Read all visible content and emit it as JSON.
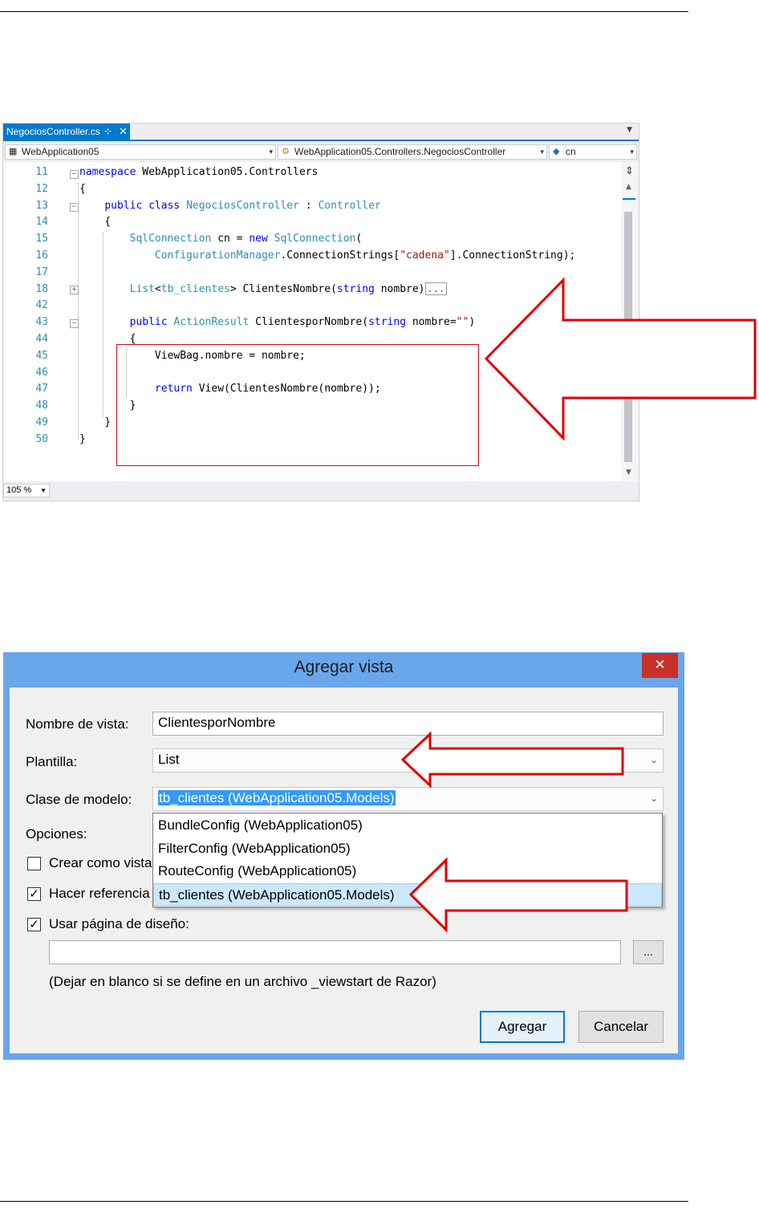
{
  "editor": {
    "tab": {
      "label": "NegociosController.cs",
      "pin_icon": "pin-icon",
      "close_icon": "close-icon"
    },
    "nav": {
      "project": "WebApplication05",
      "class": "WebApplication05.Controllers.NegociosController",
      "member": "cn"
    },
    "lines": [
      {
        "num": "11",
        "html": "<span class=\"kw\">namespace</span> WebApplication05.Controllers"
      },
      {
        "num": "12",
        "html": "{"
      },
      {
        "num": "13",
        "html": "    <span class=\"kw\">public</span> <span class=\"kw\">class</span> <span class=\"ty\">NegociosController</span> : <span class=\"ty\">Controller</span>"
      },
      {
        "num": "14",
        "html": "    {"
      },
      {
        "num": "15",
        "html": "        <span class=\"ty\">SqlConnection</span> cn = <span class=\"kw\">new</span> <span class=\"ty\">SqlConnection</span>("
      },
      {
        "num": "16",
        "html": "            <span class=\"ty\">ConfigurationManager</span>.ConnectionStrings[<span class=\"str\">\"cadena\"</span>].ConnectionString);"
      },
      {
        "num": "17",
        "html": ""
      },
      {
        "num": "18",
        "html": "        <span class=\"ty\">List</span>&lt;<span class=\"ty\">tb_clientes</span>&gt; ClientesNombre(<span class=\"kw\">string</span> nombre)<span class=\"collapsed\">...</span>"
      },
      {
        "num": "42",
        "html": ""
      },
      {
        "num": "43",
        "html": "        <span class=\"kw\">public</span> <span class=\"ty\">ActionResult</span> ClientesporNombre(<span class=\"kw\">string</span> nombre=<span class=\"str\">\"\"</span>)"
      },
      {
        "num": "44",
        "html": "        {"
      },
      {
        "num": "45",
        "html": "            ViewBag.nombre = nombre;"
      },
      {
        "num": "46",
        "html": ""
      },
      {
        "num": "47",
        "html": "            <span class=\"kw\">return</span> View(ClientesNombre(nombre));"
      },
      {
        "num": "48",
        "html": "        }"
      },
      {
        "num": "49",
        "html": "    }"
      },
      {
        "num": "50",
        "html": "}"
      }
    ],
    "zoom": "105 %"
  },
  "dialog": {
    "title": "Agregar vista",
    "close_icon": "close-icon",
    "view_name_label": "Nombre de vista:",
    "view_name_value": "ClientesporNombre",
    "template_label": "Plantilla:",
    "template_value": "List",
    "model_label": "Clase de modelo:",
    "model_value": "tb_clientes (WebApplication05.Models)",
    "model_options": [
      "BundleConfig (WebApplication05)",
      "FilterConfig (WebApplication05)",
      "RouteConfig (WebApplication05)",
      "tb_clientes (WebApplication05.Models)"
    ],
    "options_label": "Opciones:",
    "opt_partial": "Crear como vista",
    "opt_reference": "Hacer referencia a",
    "opt_layout": "Usar página de diseño:",
    "layout_path": "",
    "browse": "...",
    "hint": "(Dejar en blanco si se define en un archivo _viewstart de Razor)",
    "add": "Agregar",
    "cancel": "Cancelar"
  },
  "colors": {
    "accent": "#007acc",
    "arrow": "#e00000",
    "dialog_frame": "#6aa6ea",
    "close_red": "#c7312a"
  }
}
